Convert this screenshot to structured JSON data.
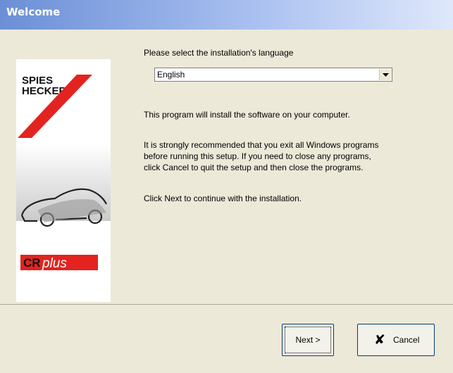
{
  "window": {
    "title": "Welcome"
  },
  "branding": {
    "logo_line1": "SPIES",
    "logo_line2": "HECKER",
    "product_cr": "CR",
    "product_plus": "plus"
  },
  "language": {
    "label": "Please select the installation's language",
    "selected": "English"
  },
  "text": {
    "p1": "This program will install the software on your computer.",
    "p2_l1": "It is strongly recommended that you exit all Windows programs",
    "p2_l2": "before running this setup. If you need to close any programs,",
    "p2_l3": "click Cancel to quit the setup and then close the programs.",
    "p3": "Click Next to continue with the installation."
  },
  "buttons": {
    "next": "Next >",
    "cancel": "Cancel"
  },
  "colors": {
    "brand_red": "#e3231f",
    "title_bar": "#6b8fd6"
  }
}
